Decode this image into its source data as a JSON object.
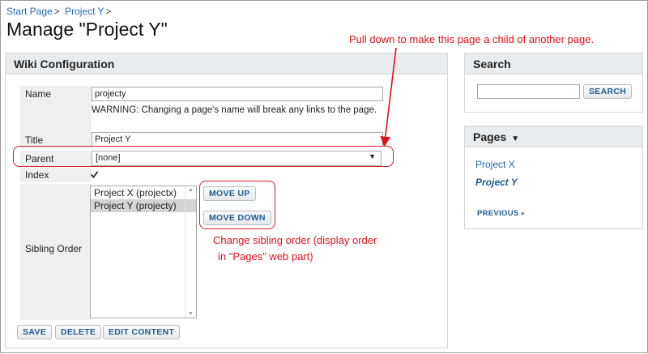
{
  "breadcrumb": {
    "items": [
      "Start Page",
      "Project Y"
    ],
    "separator": ">"
  },
  "page_title": "Manage \"Project Y\"",
  "wiki_config": {
    "header": "Wiki Configuration",
    "name_label": "Name",
    "name_value": "projecty",
    "name_warning": "WARNING: Changing a page's name will break any links to the page.",
    "title_label": "Title",
    "title_value": "Project Y",
    "parent_label": "Parent",
    "parent_value": "[none]",
    "index_label": "Index",
    "index_checked": true,
    "sibling_label": "Sibling Order",
    "sibling_options": [
      "Project X (projectx)",
      "Project Y (projecty)"
    ],
    "move_up": "MOVE UP",
    "move_down": "MOVE DOWN",
    "save": "SAVE",
    "delete": "DELETE",
    "edit_content": "EDIT CONTENT"
  },
  "search": {
    "header": "Search",
    "button": "SEARCH"
  },
  "pages": {
    "header": "Pages",
    "items": [
      "Project X",
      "Project Y"
    ],
    "previous": "PREVIOUS"
  },
  "annotations": {
    "parent_note": "Pull down to make this page a child of another page.",
    "sibling_note_line1": "Change sibling order (display order",
    "sibling_note_line2": "in \"Pages\" web part)"
  },
  "colors": {
    "annotation": "#e0121b",
    "link": "#1f6bb5",
    "panel_header": "#e9ecef"
  }
}
